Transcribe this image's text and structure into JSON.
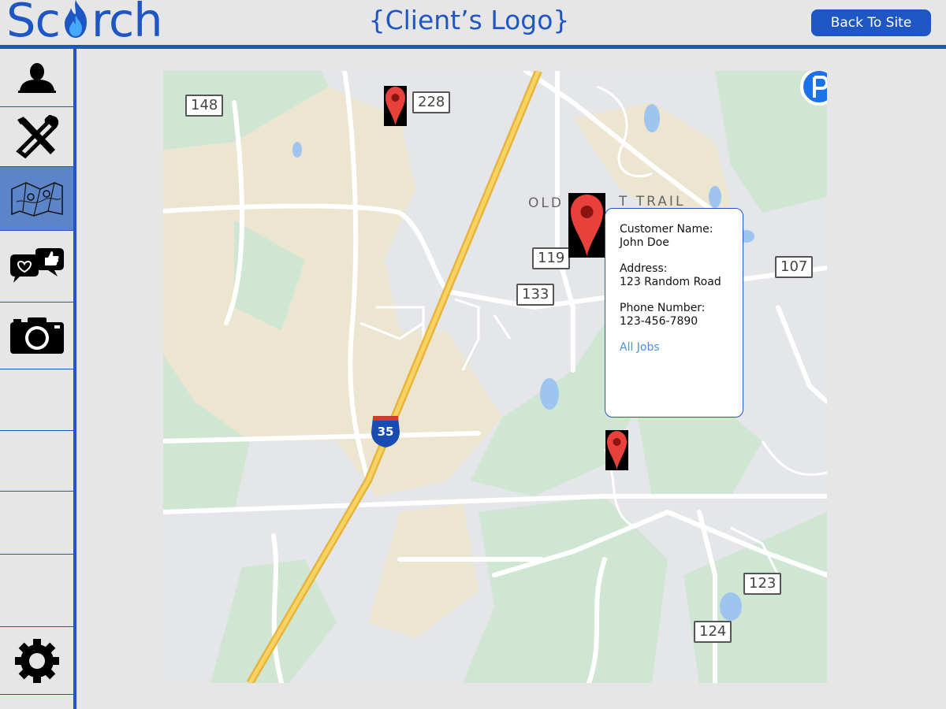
{
  "header": {
    "brand_prefix": "Sc",
    "brand_suffix": "rch",
    "client_logo": "{Client’s Logo}",
    "back_button": "Back To Site"
  },
  "sidebar": {
    "items": [
      {
        "icon": "user-icon",
        "active": false
      },
      {
        "icon": "tools-icon",
        "active": false
      },
      {
        "icon": "map-icon",
        "active": true
      },
      {
        "icon": "reviews-icon",
        "active": false
      },
      {
        "icon": "camera-icon",
        "active": false
      },
      {
        "icon": "",
        "active": false
      },
      {
        "icon": "",
        "active": false
      },
      {
        "icon": "",
        "active": false
      },
      {
        "icon": "settings-icon",
        "active": false
      }
    ]
  },
  "map": {
    "route_labels": [
      "148",
      "228",
      "119",
      "133",
      "107",
      "123",
      "124"
    ],
    "interstate": "35",
    "trail_label_left": "OLD",
    "trail_label_right": "T TRAIL"
  },
  "popup": {
    "name_label": "Customer Name:",
    "name_value": "John Doe",
    "address_label": "Address:",
    "address_value": "123 Random Road",
    "phone_label": "Phone Number:",
    "phone_value": "123-456-7890",
    "link": "All Jobs"
  },
  "colors": {
    "brand_blue": "#1e56c4",
    "active_nav": "#5b84c9",
    "pin_red": "#e8403a",
    "link_blue": "#4a90e2"
  }
}
